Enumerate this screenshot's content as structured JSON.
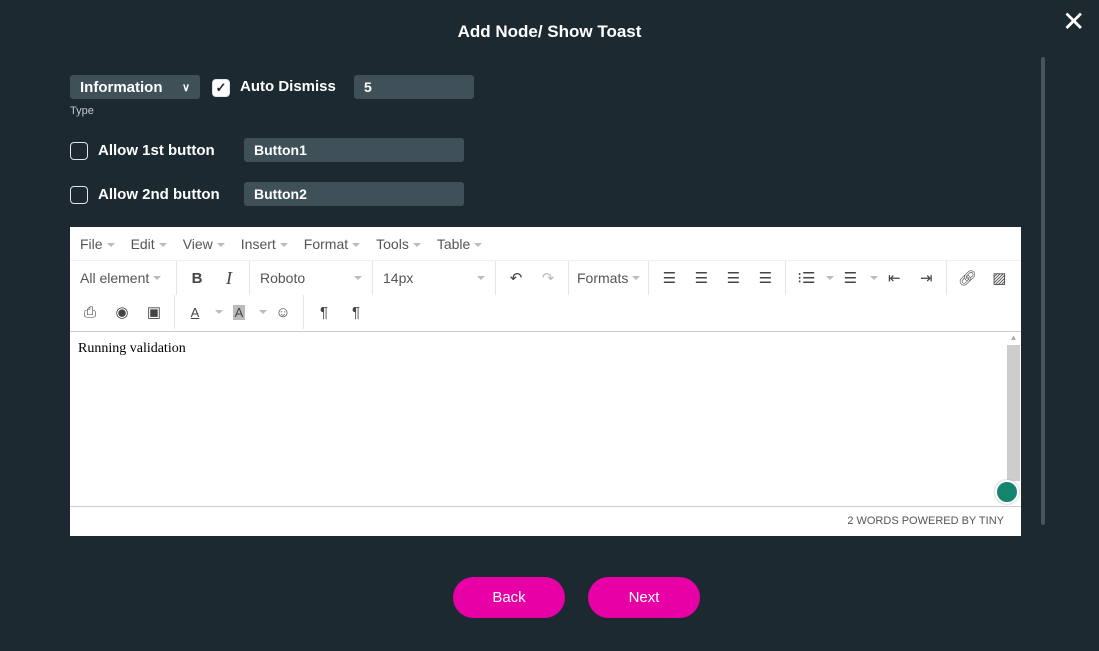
{
  "dialog": {
    "title": "Add Node/ Show Toast"
  },
  "type": {
    "value": "Information",
    "label": "Type"
  },
  "auto_dismiss": {
    "label": "Auto Dismiss",
    "checked": true,
    "value": "5"
  },
  "button1": {
    "label": "Allow 1st button",
    "checked": false,
    "value": "Button1"
  },
  "button2": {
    "label": "Allow 2nd button",
    "checked": false,
    "value": "Button2"
  },
  "editor": {
    "menu": [
      "File",
      "Edit",
      "View",
      "Insert",
      "Format",
      "Tools",
      "Table"
    ],
    "element_select": "All element",
    "font": "Roboto",
    "size": "14px",
    "formats": "Formats",
    "content": "Running validation",
    "status": "2 WORDS POWERED BY TINY"
  },
  "footer": {
    "back": "Back",
    "next": "Next"
  },
  "colors": {
    "background": "#1c2930",
    "input": "#3f5058",
    "accent": "#e600a6",
    "grammarly": "#15846f"
  }
}
